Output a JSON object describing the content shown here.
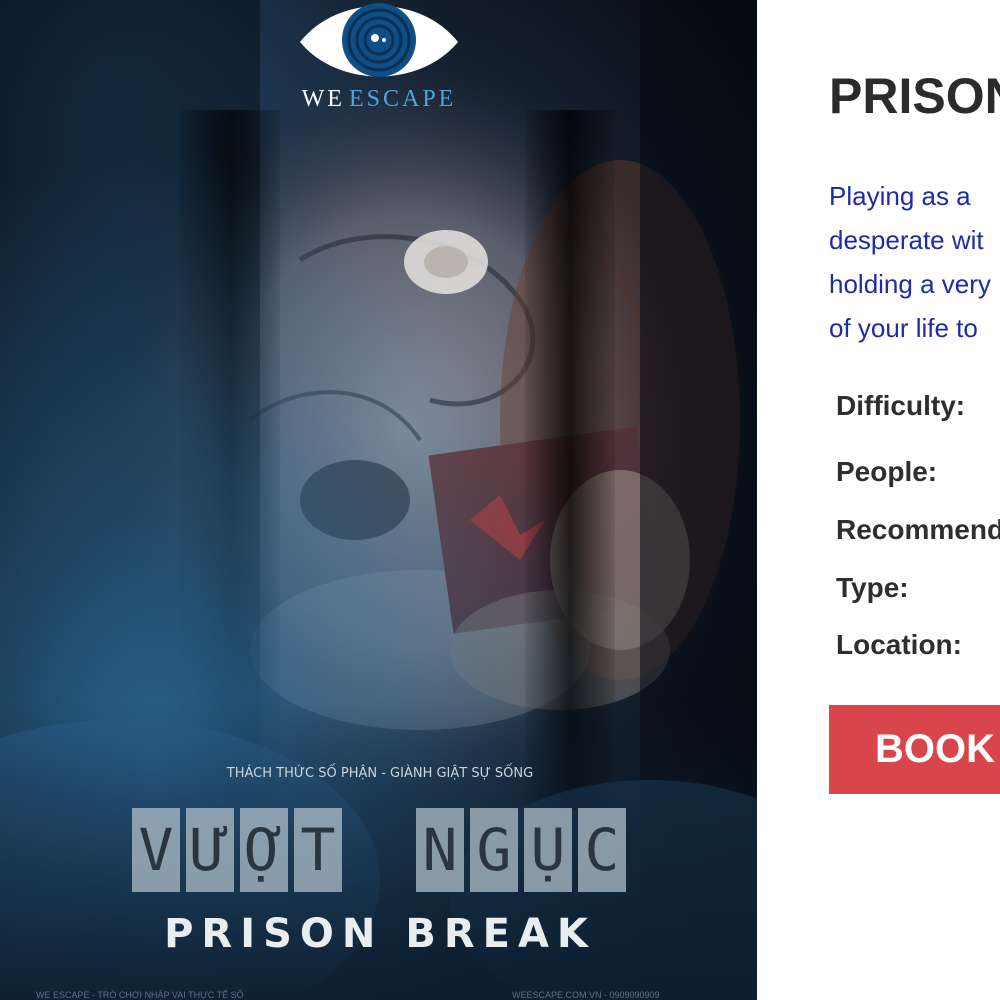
{
  "poster": {
    "logo": {
      "word1": "WE",
      "word2": "ESCAPE"
    },
    "tagline": "THÁCH THỨC SỐ PHẬN - GIÀNH GIẬT SỰ SỐNG",
    "title_vi_word1": [
      "V",
      "Ư",
      "Ợ",
      "T"
    ],
    "title_vi_word2": [
      "N",
      "G",
      "Ụ",
      "C"
    ],
    "title_en": "PRISON BREAK",
    "footer_left": "WE ESCAPE - TRÒ CHƠI NHẬP VAI THỰC TẾ SỐ",
    "footer_right": "WEESCAPE.COM.VN - 0909090909"
  },
  "room": {
    "title": "PRISON",
    "description_lines": [
      "Playing as a",
      "desperate wit",
      "holding a very",
      "of your life to"
    ],
    "specs": {
      "difficulty_label": "Difficulty:",
      "people_label": "People:",
      "recommended_label": "Recommend",
      "type_label": "Type:",
      "location_label": "Location:"
    },
    "book_label": "BOOK"
  },
  "colors": {
    "title_text": "#2b2b2b",
    "description_text": "#1f2aa8",
    "book_button_bg": "#d8454a",
    "logo_accent": "#4fa3d9",
    "poster_dark": "#0a1422"
  }
}
